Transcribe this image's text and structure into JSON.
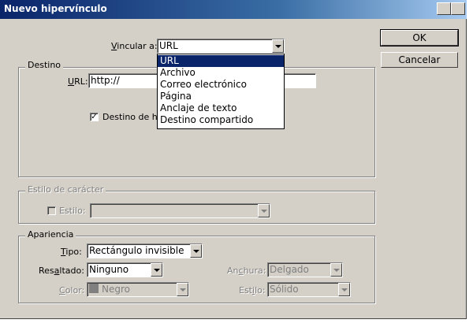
{
  "window": {
    "title": "Nuevo hipervínculo"
  },
  "link_to": {
    "label_pre": "",
    "label_u": "V",
    "label_post": "incular a:",
    "value": "URL",
    "options": [
      "URL",
      "Archivo",
      "Correo electrónico",
      "Página",
      "Anclaje de texto",
      "Destino compartido"
    ],
    "selected_index": 0
  },
  "buttons": {
    "ok": "OK",
    "cancel": "Cancelar"
  },
  "destino": {
    "title": "Destino",
    "url_label_u": "U",
    "url_label_post": "RL:",
    "url_value": "http://",
    "shared_checkbox_label": "Destino de hi",
    "shared_checked": true,
    "check_mark": "✓"
  },
  "char_style": {
    "title": "Estilo de carácter",
    "style_label": "Estilo:",
    "style_value": "",
    "checked": false
  },
  "appearance": {
    "title": "Apariencia",
    "type_label_u": "T",
    "type_label_post": "ipo:",
    "type_value": "Rectángulo invisible",
    "highlight_label_pre": "Res",
    "highlight_label_u": "a",
    "highlight_label_post": "ltado:",
    "highlight_value": "Ninguno",
    "color_label_u": "C",
    "color_label_post": "olor:",
    "color_value": "Negro",
    "color_swatch": "#808080",
    "width_label_pre": "An",
    "width_label_u": "c",
    "width_label_post": "hura:",
    "width_value": "Delgado",
    "line_style_label_pre": "Est",
    "line_style_label_u": "i",
    "line_style_label_post": "lo:",
    "line_style_value": "Sólido"
  }
}
